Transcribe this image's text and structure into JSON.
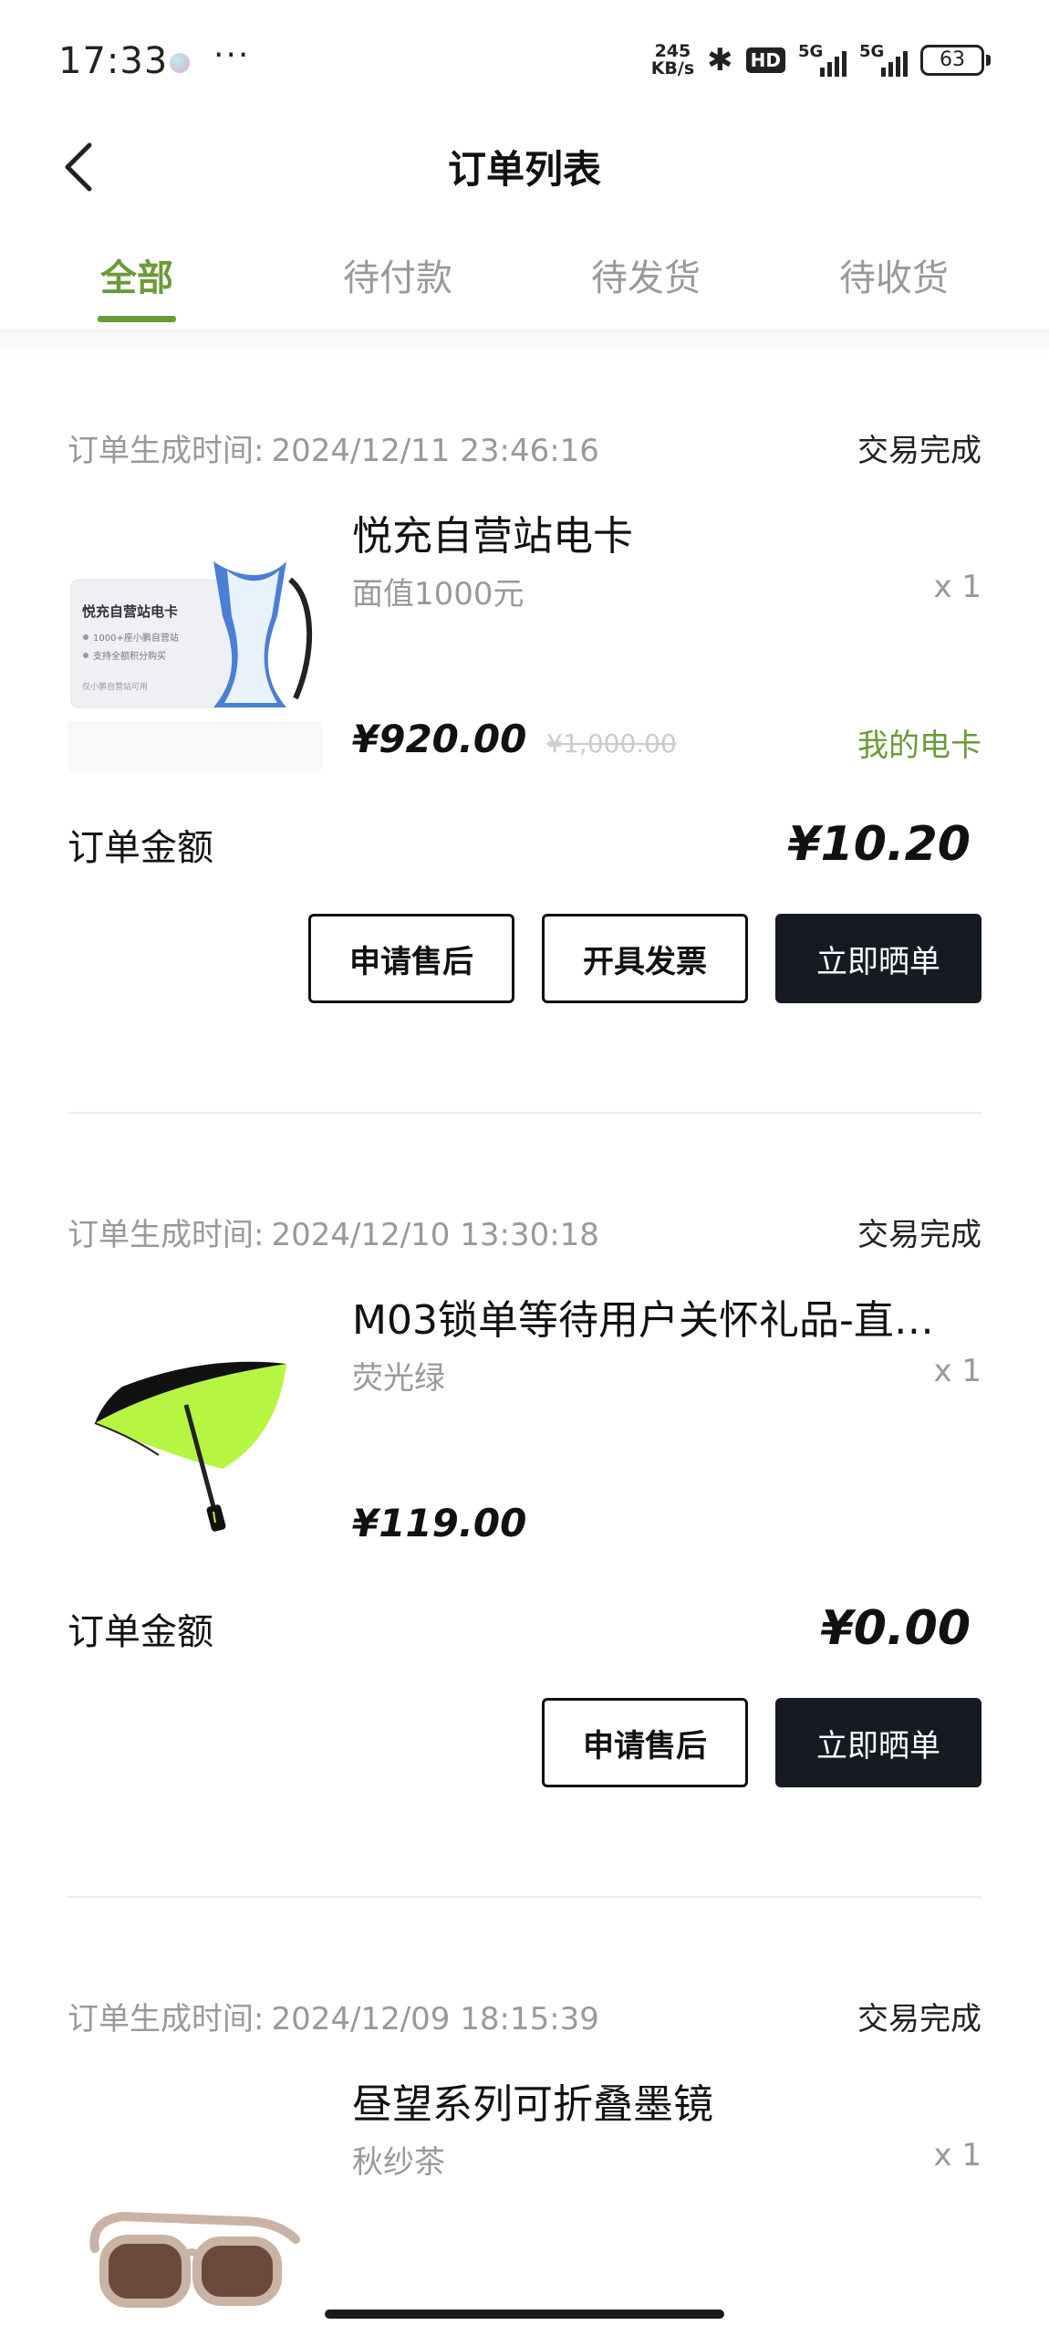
{
  "status_bar": {
    "time": "17:33",
    "more": "···",
    "net_speed_value": "245",
    "net_speed_unit": "KB/s",
    "hd_badge": "HD",
    "signal_1": "5G",
    "signal_2": "5G",
    "battery": "63"
  },
  "header": {
    "title": "订单列表",
    "back_icon": "chevron-left-icon"
  },
  "tabs": [
    {
      "label": "全部",
      "active": true
    },
    {
      "label": "待付款",
      "active": false
    },
    {
      "label": "待发货",
      "active": false
    },
    {
      "label": "待收货",
      "active": false
    }
  ],
  "colors": {
    "accent": "#6b9a3a",
    "primary_button": "#161a22",
    "muted_text": "#999999"
  },
  "orders": [
    {
      "time_label": "订单生成时间:",
      "time": "2024/12/11 23:46:16",
      "status": "交易完成",
      "product_name": "悦充自营站电卡",
      "spec": "面值1000元",
      "qty": "x 1",
      "price": "¥920.00",
      "original_price": "¥1,000.00",
      "link_text": "我的电卡",
      "total_label": "订单金额",
      "total": "¥10.20",
      "card_text": "悦充自营站电卡",
      "card_line1": "1000+座小鹏自营站",
      "card_line2": "支持全额积分购买",
      "card_footer": "仅小鹏自营站可用",
      "actions": [
        "申请售后",
        "开具发票",
        "立即晒单"
      ]
    },
    {
      "time_label": "订单生成时间:",
      "time": "2024/12/10 13:30:18",
      "status": "交易完成",
      "product_name": "M03锁单等待用户关怀礼品-直…",
      "spec": "荧光绿",
      "qty": "x 1",
      "price": "¥119.00",
      "total_label": "订单金额",
      "total": "¥0.00",
      "actions": [
        "申请售后",
        "立即晒单"
      ]
    },
    {
      "time_label": "订单生成时间:",
      "time": "2024/12/09 18:15:39",
      "status": "交易完成",
      "product_name": "昼望系列可折叠墨镜",
      "spec": "秋纱茶",
      "qty": "x 1"
    }
  ]
}
